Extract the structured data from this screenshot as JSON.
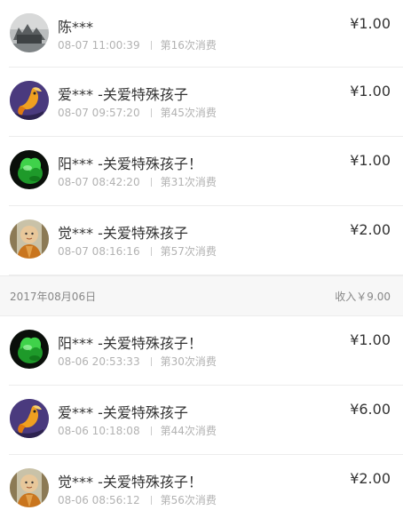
{
  "groups": [
    {
      "header": null,
      "items": [
        {
          "avatar": "photo-avatar-icon",
          "name": "陈***",
          "time": "08-07 11:00:39",
          "count": "第16次消费",
          "amount": "¥1.00"
        },
        {
          "avatar": "goldfish-avatar-icon",
          "name": "爱*** -关爱特殊孩子",
          "time": "08-07 09:57:20",
          "count": "第45次消费",
          "amount": "¥1.00"
        },
        {
          "avatar": "jade-avatar-icon",
          "name": "阳*** -关爱特殊孩子！",
          "time": "08-07 08:42:20",
          "count": "第31次消费",
          "amount": "¥1.00"
        },
        {
          "avatar": "monk-avatar-icon",
          "name": "觉*** -关爱特殊孩子",
          "time": "08-07 08:16:16",
          "count": "第57次消费",
          "amount": "¥2.00"
        }
      ]
    },
    {
      "header": {
        "date": "2017年08月06日",
        "income": "收入￥9.00"
      },
      "items": [
        {
          "avatar": "jade-avatar-icon",
          "name": "阳*** -关爱特殊孩子！",
          "time": "08-06 20:53:33",
          "count": "第30次消费",
          "amount": "¥1.00"
        },
        {
          "avatar": "goldfish-avatar-icon",
          "name": "爱*** -关爱特殊孩子",
          "time": "08-06 10:18:08",
          "count": "第44次消费",
          "amount": "¥6.00"
        },
        {
          "avatar": "monk-avatar-icon",
          "name": "觉*** -关爱特殊孩子！",
          "time": "08-06 08:56:12",
          "count": "第56次消费",
          "amount": "¥2.00"
        }
      ]
    }
  ]
}
